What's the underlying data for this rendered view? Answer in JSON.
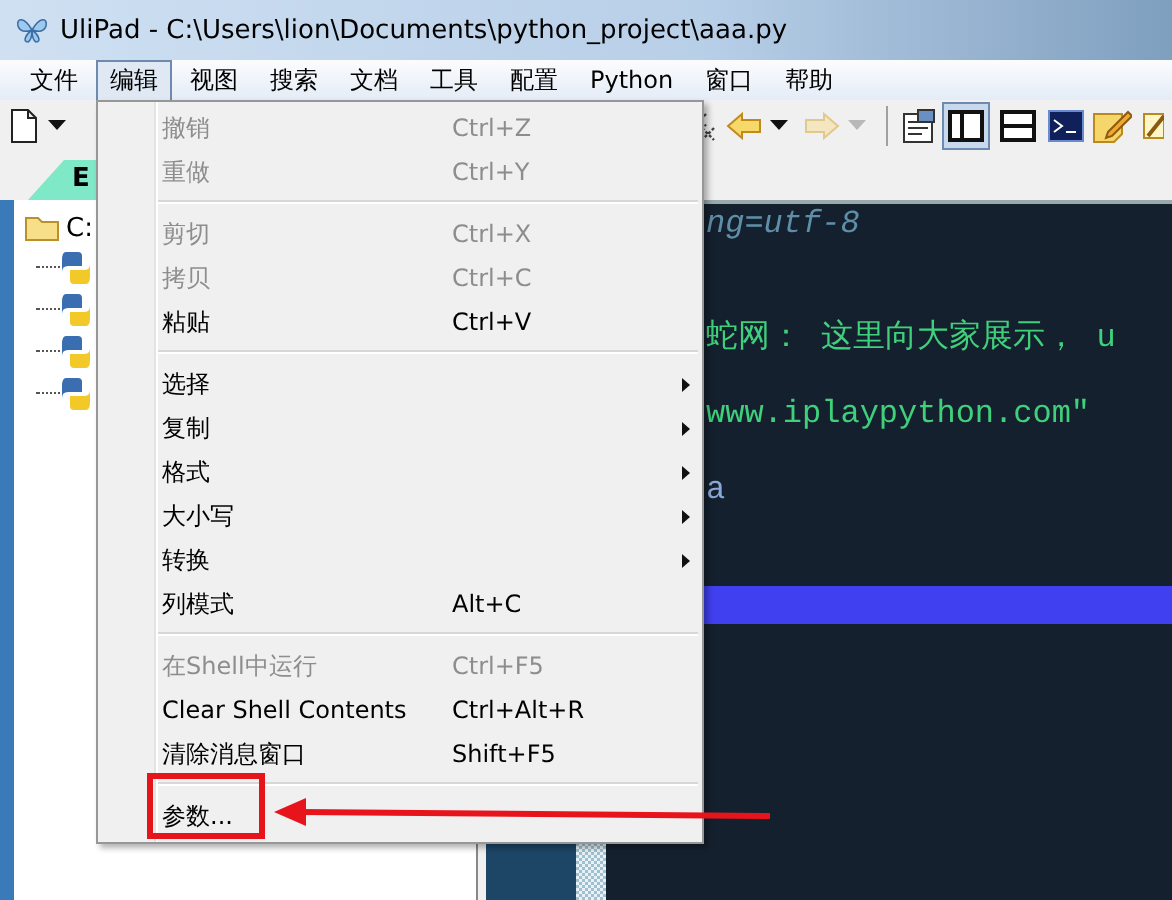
{
  "window": {
    "title": "UliPad - C:\\Users\\lion\\Documents\\python_project\\aaa.py"
  },
  "menubar": [
    {
      "label": "文件",
      "selected": false
    },
    {
      "label": "编辑",
      "selected": true
    },
    {
      "label": "视图",
      "selected": false
    },
    {
      "label": "搜索",
      "selected": false
    },
    {
      "label": "文档",
      "selected": false
    },
    {
      "label": "工具",
      "selected": false
    },
    {
      "label": "配置",
      "selected": false
    },
    {
      "label": "Python",
      "selected": false
    },
    {
      "label": "窗口",
      "selected": false
    },
    {
      "label": "帮助",
      "selected": false
    }
  ],
  "toolbar": [
    {
      "kind": "new-file"
    },
    {
      "kind": "caret"
    },
    {
      "kind": "gap"
    },
    {
      "kind": "swap"
    },
    {
      "kind": "back",
      "disabled": false
    },
    {
      "kind": "caret",
      "disabled": false
    },
    {
      "kind": "forward",
      "disabled": true
    },
    {
      "kind": "caret",
      "disabled": true
    },
    {
      "kind": "separator"
    },
    {
      "kind": "properties"
    },
    {
      "kind": "layout-vertical",
      "selected": true
    },
    {
      "kind": "layout-horizontal",
      "selected": false
    },
    {
      "kind": "shell"
    },
    {
      "kind": "note"
    },
    {
      "kind": "pencil"
    }
  ],
  "tabs": [
    {
      "label": "E",
      "selected": true
    }
  ],
  "tree": {
    "label": "C:",
    "children": [
      {
        "kind": "python-file"
      },
      {
        "kind": "python-file"
      },
      {
        "kind": "python-file"
      },
      {
        "kind": "python-file"
      }
    ]
  },
  "editor": {
    "lines": [
      {
        "kind": "comment",
        "text": "ng=utf-8"
      },
      {
        "kind": "blank"
      },
      {
        "kind": "blank"
      },
      {
        "kind": "string",
        "text": "蛇网： 这里向大家展示， u"
      },
      {
        "kind": "blank"
      },
      {
        "kind": "string",
        "text": "www.iplaypython.com\""
      },
      {
        "kind": "blank"
      },
      {
        "kind": "plain",
        "text": "a"
      },
      {
        "kind": "blank"
      },
      {
        "kind": "blank"
      },
      {
        "kind": "current"
      }
    ]
  },
  "menu": {
    "items": [
      {
        "kind": "item",
        "label": "撤销",
        "shortcut": "Ctrl+Z",
        "disabled": true,
        "submenu": false
      },
      {
        "kind": "item",
        "label": "重做",
        "shortcut": "Ctrl+Y",
        "disabled": true,
        "submenu": false
      },
      {
        "kind": "separator"
      },
      {
        "kind": "item",
        "label": "剪切",
        "shortcut": "Ctrl+X",
        "disabled": true,
        "submenu": false
      },
      {
        "kind": "item",
        "label": "拷贝",
        "shortcut": "Ctrl+C",
        "disabled": true,
        "submenu": false
      },
      {
        "kind": "item",
        "label": "粘贴",
        "shortcut": "Ctrl+V",
        "disabled": false,
        "submenu": false
      },
      {
        "kind": "separator"
      },
      {
        "kind": "item",
        "label": "选择",
        "disabled": false,
        "submenu": true
      },
      {
        "kind": "item",
        "label": "复制",
        "disabled": false,
        "submenu": true
      },
      {
        "kind": "item",
        "label": "格式",
        "disabled": false,
        "submenu": true
      },
      {
        "kind": "item",
        "label": "大小写",
        "disabled": false,
        "submenu": true
      },
      {
        "kind": "item",
        "label": "转换",
        "disabled": false,
        "submenu": true
      },
      {
        "kind": "item",
        "label": "列模式",
        "shortcut": "Alt+C",
        "disabled": false,
        "submenu": false
      },
      {
        "kind": "separator"
      },
      {
        "kind": "item",
        "label": "在Shell中运行",
        "shortcut": "Ctrl+F5",
        "disabled": true,
        "submenu": false
      },
      {
        "kind": "item",
        "label": "Clear Shell Contents",
        "shortcut": "Ctrl+Alt+R",
        "disabled": false,
        "submenu": false
      },
      {
        "kind": "item",
        "label": "清除消息窗口",
        "shortcut": "Shift+F5",
        "disabled": false,
        "submenu": false
      },
      {
        "kind": "separator"
      },
      {
        "kind": "item",
        "label": "参数...",
        "disabled": false,
        "submenu": false,
        "highlighted": true
      }
    ]
  }
}
